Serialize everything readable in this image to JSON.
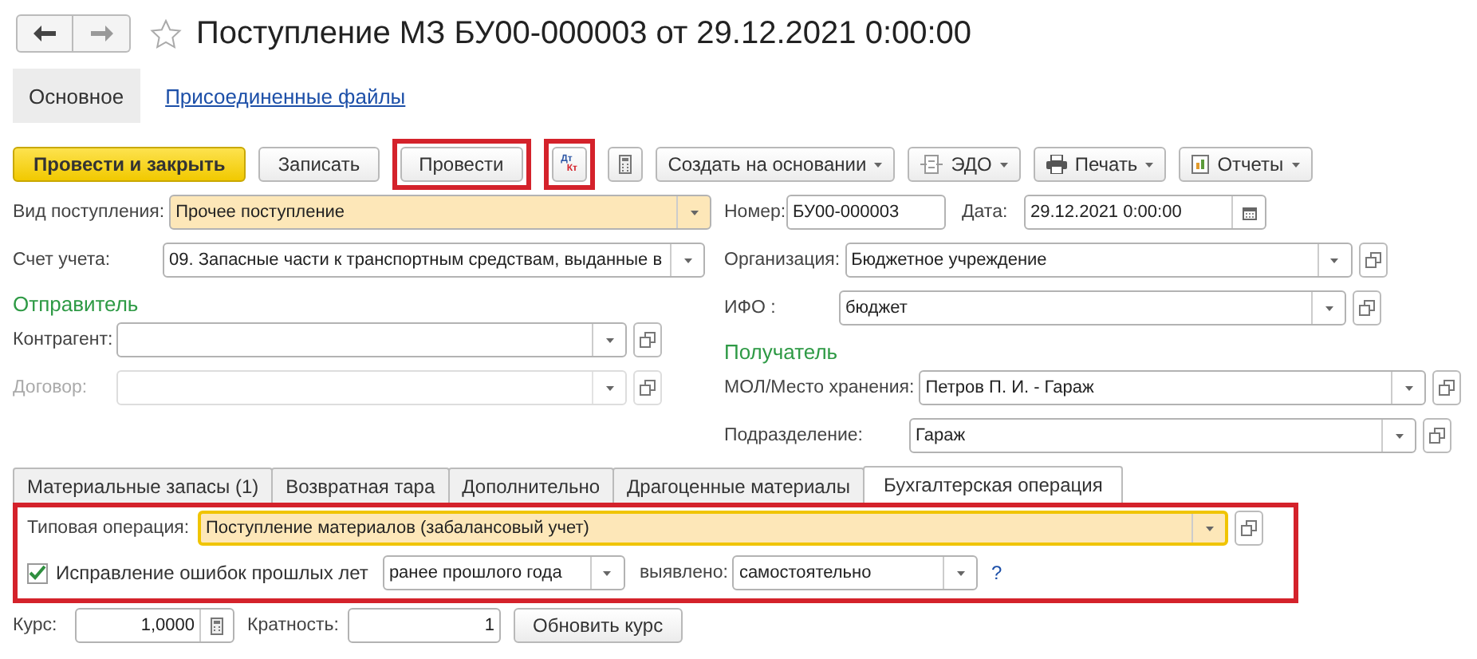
{
  "window": {
    "title": "Поступление МЗ БУ00-000003 от 29.12.2021 0:00:00",
    "favorite": false
  },
  "form_tabs": [
    {
      "label": "Основное",
      "selected": true
    },
    {
      "label": "Присоединенные файлы",
      "selected": false
    }
  ],
  "toolbar": [
    {
      "kind": "primary",
      "label": "Провести и закрыть",
      "marked": false
    },
    {
      "kind": "button",
      "label": "Записать",
      "marked": false
    },
    {
      "kind": "button",
      "label": "Провести",
      "marked": true
    },
    {
      "kind": "dtkt",
      "label_top": "Дт",
      "label_bottom": "Кт",
      "marked": true
    },
    {
      "kind": "calculator",
      "marked": false
    },
    {
      "kind": "menu",
      "label": "Создать на основании",
      "marked": false
    },
    {
      "kind": "exchange",
      "label": "ЭДО",
      "marked": false
    },
    {
      "kind": "print",
      "label": "Печать",
      "marked": false
    },
    {
      "kind": "reports",
      "label": "Отчеты",
      "marked": false
    }
  ],
  "left_sections": [
    {
      "rows": [
        [
          {
            "label": "Вид поступления:",
            "value": "Прочее поступление",
            "kind": "select",
            "highlighted": true,
            "disabled": false
          }
        ],
        [
          {
            "label": "Счет учета:",
            "value": "09. Запасные части к транспортным средствам, выданные в",
            "kind": "select",
            "highlighted": false,
            "disabled": false
          }
        ]
      ]
    },
    {
      "heading": "Отправитель",
      "rows": [
        [
          {
            "label": "Контрагент:",
            "kind": "select_open",
            "highlighted": false,
            "disabled": false
          }
        ],
        [
          {
            "label": "Договор:",
            "kind": "select_open",
            "highlighted": false,
            "disabled": true
          }
        ]
      ]
    }
  ],
  "right_sections": [
    {
      "rows": [
        [
          {
            "label": "Номер:",
            "value": "БУ00-000003",
            "kind": "text",
            "highlighted": false,
            "disabled": false
          },
          {
            "label": "Дата:",
            "value": "29.12.2021  0:00:00",
            "kind": "date",
            "highlighted": false,
            "disabled": false
          }
        ],
        [
          {
            "label": "Организация:",
            "value": "Бюджетное учреждение",
            "kind": "select_open",
            "highlighted": false,
            "disabled": false
          }
        ],
        [
          {
            "label": "ИФО :",
            "value": "бюджет",
            "kind": "select_open",
            "highlighted": false,
            "disabled": false
          }
        ]
      ]
    },
    {
      "heading": "Получатель",
      "rows": [
        [
          {
            "label": "МОЛ/Место хранения:",
            "value": "Петров П. И. - Гараж",
            "kind": "select_open",
            "highlighted": false,
            "disabled": false
          }
        ],
        [
          {
            "label": "Подразделение:",
            "value": "Гараж",
            "kind": "select_open",
            "highlighted": false,
            "disabled": false
          }
        ]
      ]
    }
  ],
  "tabs": [
    {
      "label": "Материальные запасы (1)",
      "selected": false
    },
    {
      "label": "Возвратная тара",
      "selected": false
    },
    {
      "label": "Дополнительно",
      "selected": false
    },
    {
      "label": "Драгоценные материалы",
      "selected": false
    },
    {
      "label": "Бухгалтерская операция",
      "selected": true
    }
  ],
  "operation_panel": {
    "marked": true,
    "operation": {
      "label": "Типовая операция:",
      "value": "Поступление материалов (забалансовый учет)",
      "highlighted": true,
      "focused": true
    },
    "correction": {
      "checked": true,
      "label": "Исправление ошибок прошлых лет",
      "period": "ранее прошлого года",
      "found_label": "выявлено:",
      "found": "самостоятельно",
      "help": "?"
    }
  },
  "rate": {
    "label": "Курс:",
    "value": "1,0000",
    "multiplicity_label": "Кратность:",
    "multiplicity": "1",
    "button": "Обновить курс"
  }
}
